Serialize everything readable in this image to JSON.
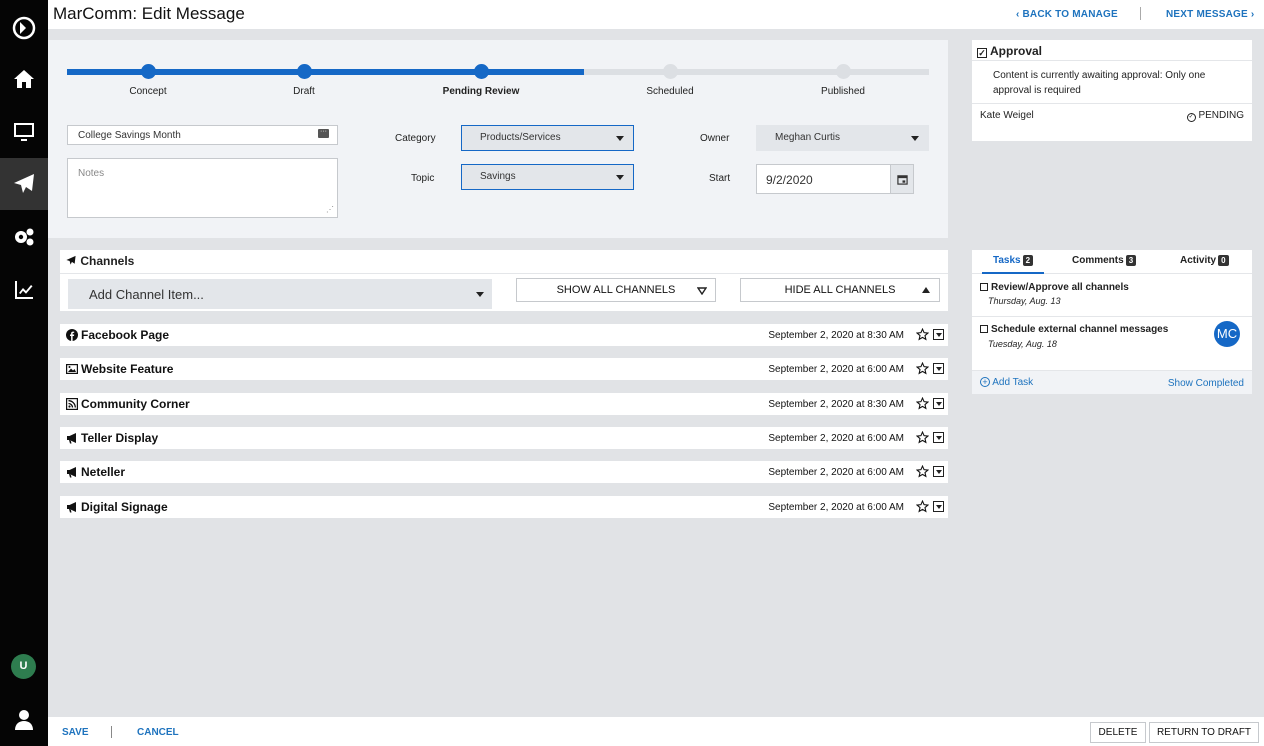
{
  "header": {
    "title": "MarComm: Edit Message",
    "back_label": "BACK TO MANAGE",
    "next_label": "NEXT MESSAGE"
  },
  "sidebar": {
    "user_initial": "U",
    "items": [
      "home",
      "monitor",
      "send",
      "settings",
      "analytics"
    ]
  },
  "progress": {
    "steps": [
      "Concept",
      "Draft",
      "Pending Review",
      "Scheduled",
      "Published"
    ],
    "current_step": "Pending Review",
    "current_index": 2
  },
  "form": {
    "title_value": "College Savings Month",
    "notes_placeholder": "Notes",
    "category_label": "Category",
    "category_value": "Products/Services",
    "topic_label": "Topic",
    "topic_value": "Savings",
    "owner_label": "Owner",
    "owner_value": "Meghan Curtis",
    "start_label": "Start",
    "start_value": "9/2/2020"
  },
  "approval": {
    "title": "Approval",
    "message": "Content is currently awaiting approval: Only one approval is required",
    "approver": "Kate Weigel",
    "status": "PENDING"
  },
  "channels": {
    "title": "Channels",
    "add_placeholder": "Add Channel Item...",
    "show_all": "SHOW ALL CHANNELS",
    "hide_all": "HIDE ALL CHANNELS",
    "items": [
      {
        "name": "Facebook Page",
        "date": "September 2, 2020 at 8:30 AM",
        "icon": "facebook-icon"
      },
      {
        "name": "Website Feature",
        "date": "September 2, 2020 at 6:00 AM",
        "icon": "image-icon"
      },
      {
        "name": "Community Corner",
        "date": "September 2, 2020 at 8:30 AM",
        "icon": "rss-icon"
      },
      {
        "name": "Teller Display",
        "date": "September 2, 2020 at 6:00 AM",
        "icon": "megaphone-icon"
      },
      {
        "name": "Neteller",
        "date": "September 2, 2020 at 6:00 AM",
        "icon": "megaphone-icon"
      },
      {
        "name": "Digital Signage",
        "date": "September 2, 2020 at 6:00 AM",
        "icon": "megaphone-icon"
      }
    ]
  },
  "tasks_panel": {
    "tabs": [
      {
        "label": "Tasks",
        "count": "2"
      },
      {
        "label": "Comments",
        "count": "3"
      },
      {
        "label": "Activity",
        "count": "0"
      }
    ],
    "tasks": [
      {
        "title": "Review/Approve all channels",
        "date": "Thursday, Aug. 13"
      },
      {
        "title": "Schedule external channel messages",
        "date": "Tuesday, Aug. 18",
        "assignee": "MC"
      }
    ],
    "add_task": "Add Task",
    "show_completed": "Show Completed"
  },
  "footer": {
    "save": "SAVE",
    "cancel": "CANCEL",
    "delete": "DELETE",
    "return_to_draft": "RETURN TO DRAFT"
  },
  "colors": {
    "accent": "#1568c6",
    "sidebar": "#050505",
    "avatar_user": "#2e7d4f"
  }
}
